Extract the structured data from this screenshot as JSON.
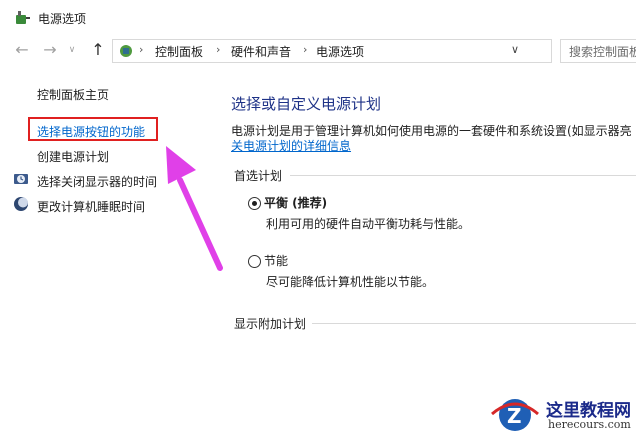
{
  "window": {
    "title": "电源选项"
  },
  "nav": {
    "back_icon": "←",
    "forward_icon": "→",
    "up_icon": "↑",
    "breadcrumbs": [
      "控制面板",
      "硬件和声音",
      "电源选项"
    ],
    "search_placeholder": "搜索控制面板"
  },
  "sidebar": {
    "home": "控制面板主页",
    "items": [
      "选择电源按钮的功能",
      "创建电源计划",
      "选择关闭显示器的时间",
      "更改计算机睡眠时间"
    ]
  },
  "main": {
    "heading": "选择或自定义电源计划",
    "description": "电源计划是用于管理计算机如何使用电源的一套硬件和系统设置(如显示器亮",
    "details_link": "关电源计划的详细信息",
    "preferred_title": "首选计划",
    "plans": [
      {
        "name": "平衡 (推荐)",
        "desc": "利用可用的硬件自动平衡功耗与性能。",
        "selected": true
      },
      {
        "name": "节能",
        "desc": "尽可能降低计算机性能以节能。",
        "selected": false
      }
    ],
    "additional_title": "显示附加计划"
  },
  "watermark": {
    "title": "这里教程网",
    "url": "herecours.com"
  },
  "colors": {
    "link": "#0066cc",
    "heading": "#1e3287",
    "highlight": "#e02020",
    "arrow": "#e040e8"
  }
}
